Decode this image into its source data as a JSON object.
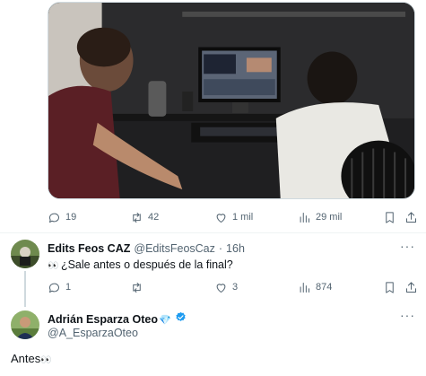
{
  "post": {
    "actions": {
      "replies": "19",
      "retweets": "42",
      "likes": "1 mil",
      "views": "29 mil"
    }
  },
  "reply": {
    "name": "Edits Feos CAZ",
    "handle": "@EditsFeosCaz",
    "separator": "·",
    "time": "16h",
    "text_emoji": "👀",
    "text": "¿Sale antes o después de la final?",
    "actions": {
      "replies": "1",
      "retweets": "",
      "likes": "3",
      "views": "874"
    }
  },
  "composer_author": {
    "name": "Adrián Esparza Oteo",
    "diamond_emoji": "💎",
    "handle": "@A_EsparzaOteo",
    "text": "Antes",
    "text_emoji": "👀"
  },
  "icons": {
    "reply": "speech-bubble-icon",
    "retweet": "retweet-arrows-icon",
    "like": "heart-icon",
    "views": "bar-chart-icon",
    "bookmark": "bookmark-icon",
    "share": "share-upload-icon",
    "more": "more-dots-icon",
    "verified": "verified-badge-icon"
  },
  "colors": {
    "text_primary": "#0f1419",
    "text_secondary": "#536471",
    "verified_blue": "#1d9bf0",
    "divider": "#eff3f4"
  }
}
